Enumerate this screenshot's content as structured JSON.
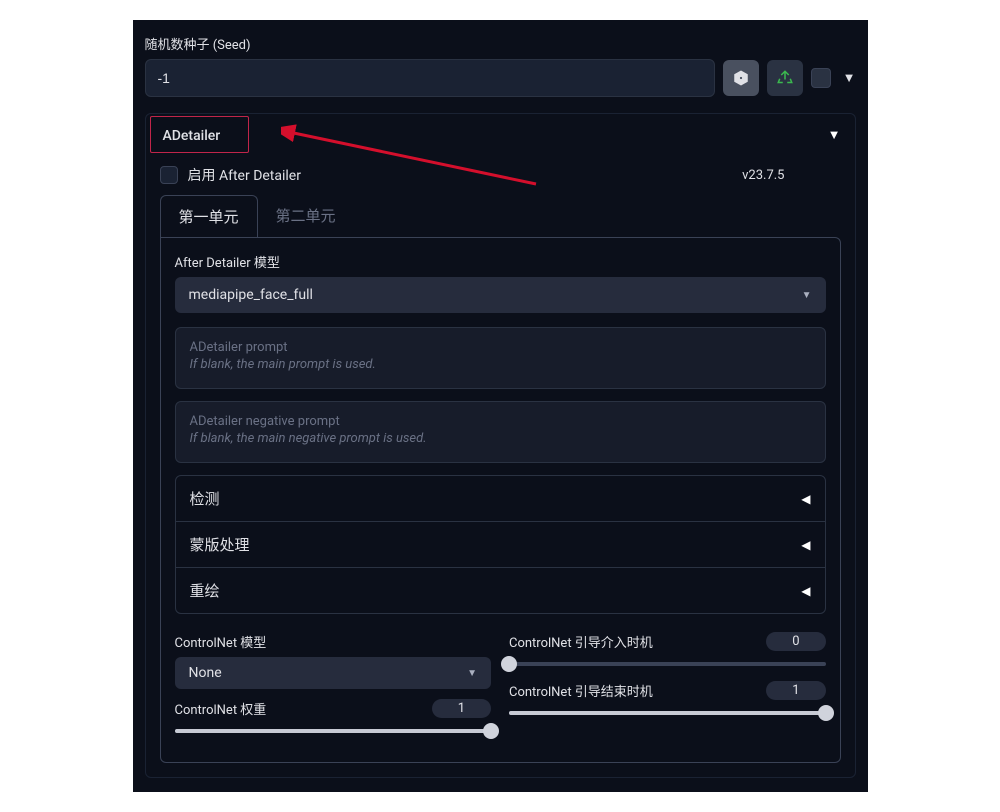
{
  "seed": {
    "label": "随机数种子 (Seed)",
    "value": "-1",
    "dice_icon": "dice-icon",
    "recycle_icon": "recycle-icon"
  },
  "adetailer": {
    "title": "ADetailer",
    "enable_label": "启用 After Detailer",
    "version": "v23.7.5",
    "tabs": {
      "tab1": "第一单元",
      "tab2": "第二单元"
    },
    "model_label": "After Detailer 模型",
    "model_value": "mediapipe_face_full",
    "prompt_placeholder_line1": "ADetailer prompt",
    "prompt_placeholder_line2": "If blank, the main prompt is used.",
    "neg_prompt_placeholder_line1": "ADetailer negative prompt",
    "neg_prompt_placeholder_line2": "If blank, the main negative prompt is used.",
    "accordions": {
      "detect": "检测",
      "mask": "蒙版处理",
      "inpaint": "重绘"
    },
    "controlnet": {
      "model_label": "ControlNet 模型",
      "model_value": "None",
      "weight_label": "ControlNet 权重",
      "weight_value": "1",
      "start_label": "ControlNet 引导介入时机",
      "start_value": "0",
      "end_label": "ControlNet 引导结束时机",
      "end_value": "1"
    }
  }
}
